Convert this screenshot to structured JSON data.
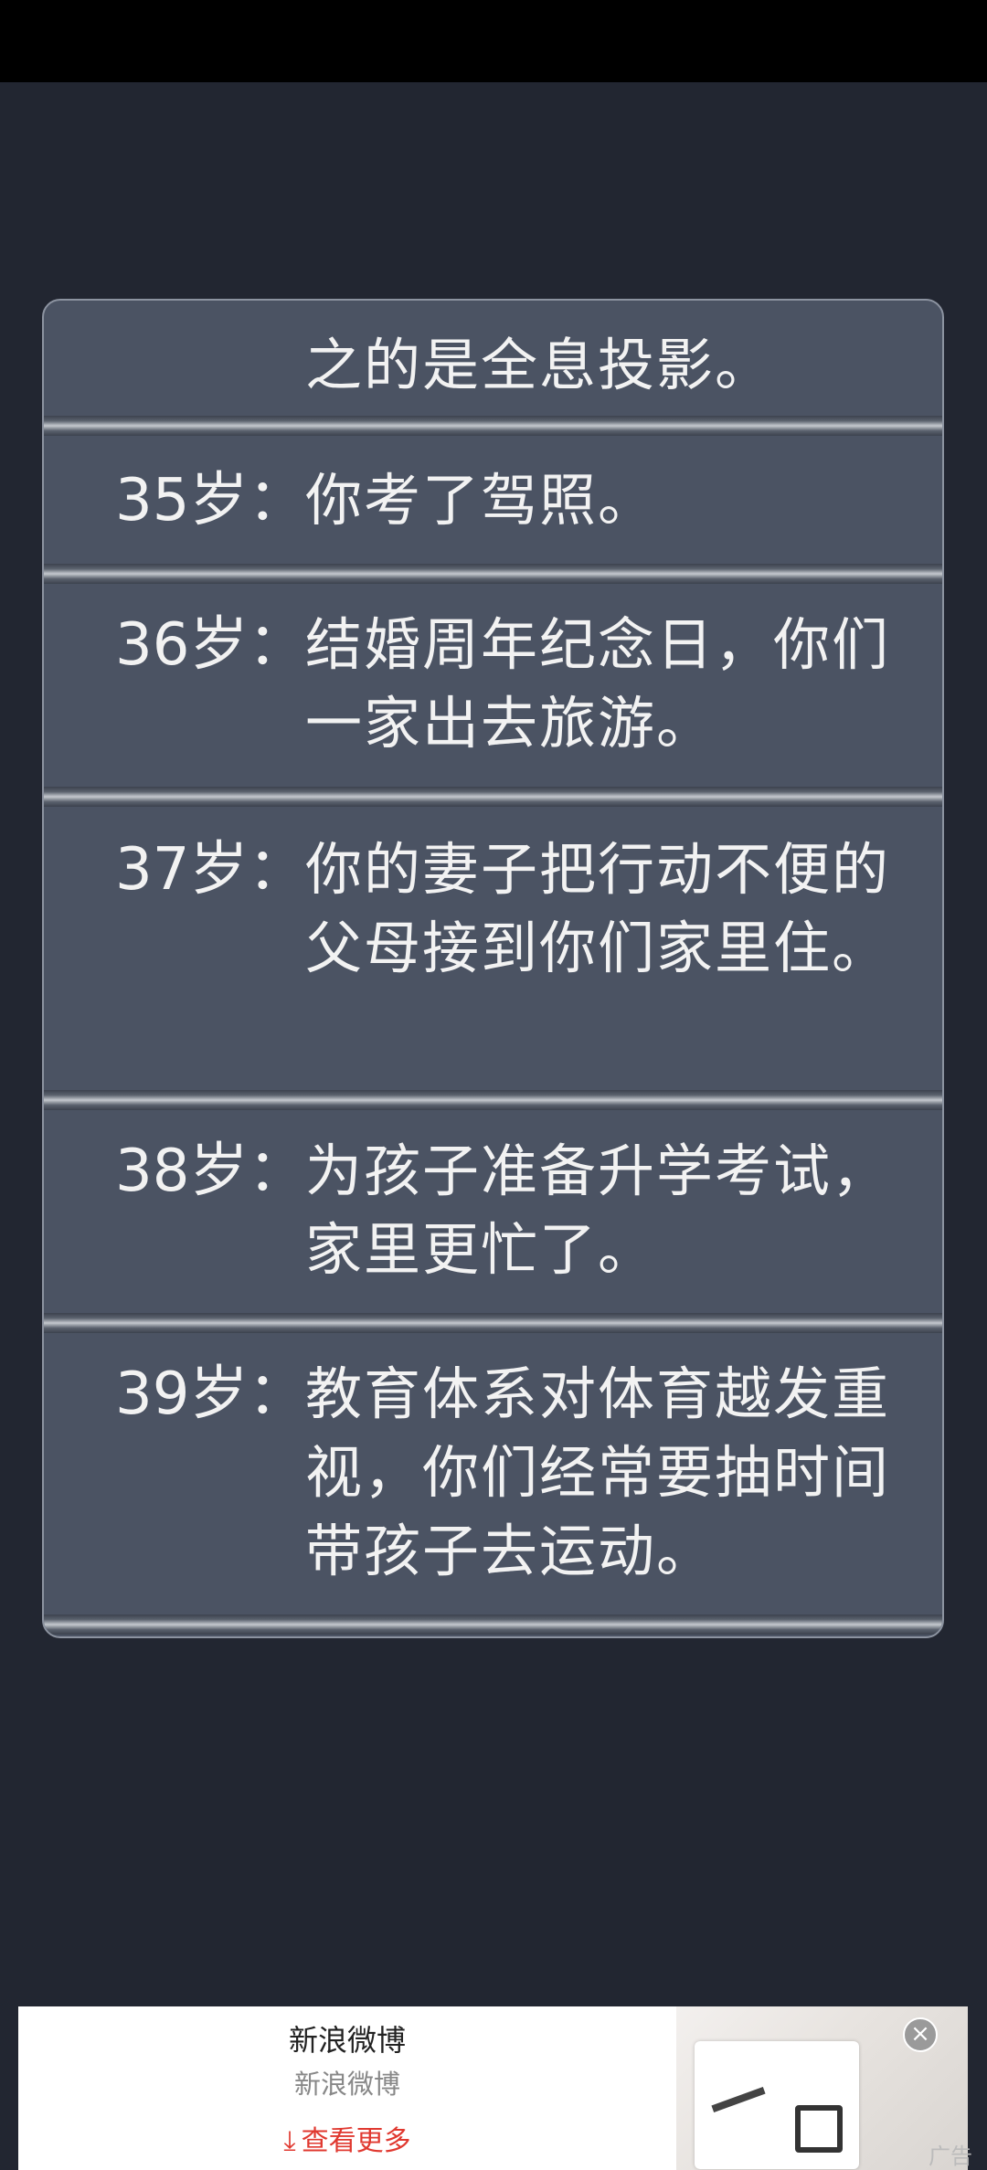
{
  "panel": {
    "top_partial_text": "之的是全息投影。",
    "entries": [
      {
        "age": "35岁：",
        "text": "你考了驾照。"
      },
      {
        "age": "36岁：",
        "text": "结婚周年纪念日，你们一家出去旅游。"
      },
      {
        "age": "37岁：",
        "text": "你的妻子把行动不便的父母接到你们家里住。"
      },
      {
        "age": "38岁：",
        "text": "为孩子准备升学考试，家里更忙了。"
      },
      {
        "age": "39岁：",
        "text": "教育体系对体育越发重视，你们经常要抽时间带孩子去运动。"
      }
    ]
  },
  "ad": {
    "title": "新浪微博",
    "subtitle": "新浪微博",
    "more_label": "查看更多",
    "download_icon": "⤓",
    "close_icon": "×",
    "ad_label": "广告"
  }
}
